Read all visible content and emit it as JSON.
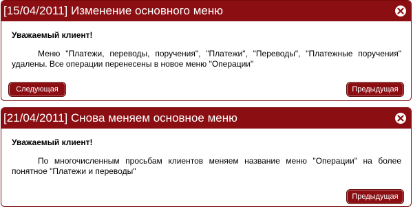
{
  "notices": [
    {
      "title": "[15/04/2011] Изменение основного меню",
      "greeting": "Уважаемый клиент!",
      "message": "Меню \"Платежи, переводы, поручения\", \"Платежи\", \"Переводы\", \"Платежные поручения\" удалены. Все операции перенесены в новое меню \"Операции\"",
      "next_label": "Следующая",
      "prev_label": "Предыдущая"
    },
    {
      "title": "[21/04/2011] Снова меняем основное меню",
      "greeting": "Уважаемый клиент!",
      "message": "По многочисленным просьбам клиентов меняем название меню \"Операции\" на более понятное \"Платежи и переводы\"",
      "prev_label": "Предыдущая"
    }
  ],
  "colors": {
    "accent": "#8b0e12",
    "text": "#000000",
    "background": "#ffffff"
  },
  "icons": {
    "close": "close-icon"
  }
}
